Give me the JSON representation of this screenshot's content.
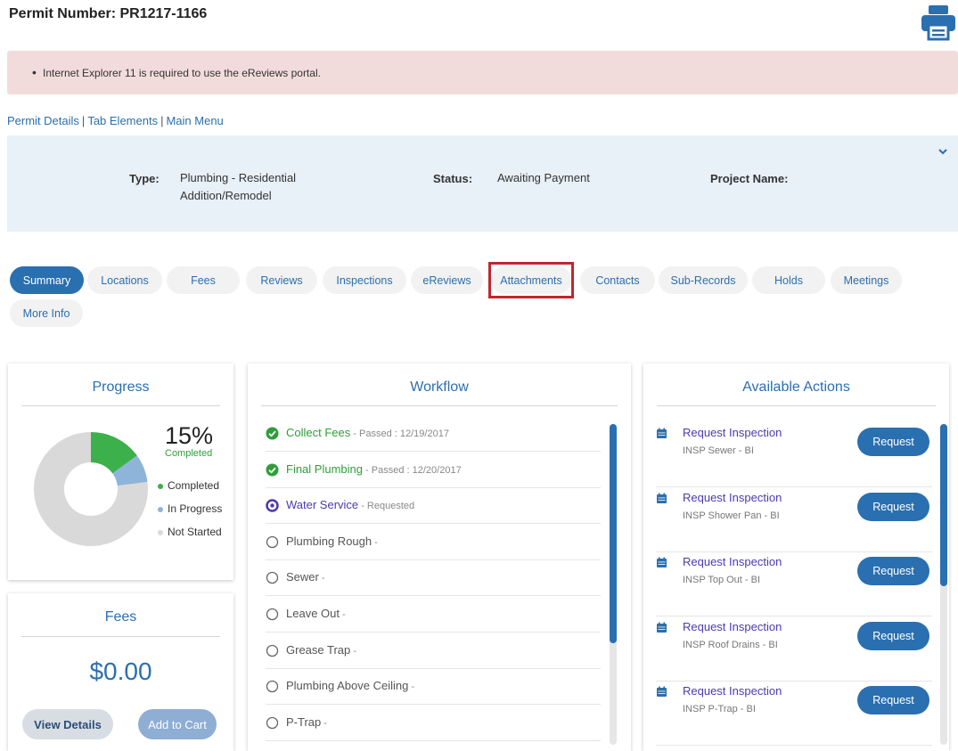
{
  "header": {
    "permit_title": "Permit Number: PR1217-1166",
    "print_icon": "print-icon"
  },
  "alert": {
    "message": "Internet Explorer 11 is required to use the eReviews portal."
  },
  "breadcrumb": {
    "items": [
      "Permit Details",
      "Tab Elements",
      "Main Menu"
    ],
    "separator": "|"
  },
  "info": {
    "type_label": "Type:",
    "type_value_line1": "Plumbing - Residential",
    "type_value_line2": "Addition/Remodel",
    "status_label": "Status:",
    "status_value": "Awaiting Payment",
    "project_label": "Project Name:",
    "project_value": ""
  },
  "tabs": [
    {
      "label": "Summary",
      "active": true
    },
    {
      "label": "Locations"
    },
    {
      "label": "Fees"
    },
    {
      "label": "Reviews"
    },
    {
      "label": "Inspections"
    },
    {
      "label": "eReviews"
    },
    {
      "label": "Attachments",
      "highlighted": true
    },
    {
      "label": "Contacts"
    },
    {
      "label": "Sub-Records"
    },
    {
      "label": "Holds"
    },
    {
      "label": "Meetings"
    },
    {
      "label": "More Info"
    }
  ],
  "progress": {
    "title": "Progress",
    "percent_text": "15%",
    "completed_text": "Completed",
    "legend": [
      {
        "label": "Completed",
        "color": "#3cb04a"
      },
      {
        "label": "In Progress",
        "color": "#8fb4d9"
      },
      {
        "label": "Not Started",
        "color": "#d9d9d9"
      }
    ],
    "completed_fraction": 0.15,
    "in_progress_fraction": 0.08
  },
  "fees": {
    "title": "Fees",
    "amount": "$0.00",
    "view_details_label": "View Details",
    "add_to_cart_label": "Add to Cart"
  },
  "workflow": {
    "title": "Workflow",
    "items": [
      {
        "name": "Collect Fees",
        "status": " - Passed : 12/19/2017",
        "state": "passed"
      },
      {
        "name": "Final Plumbing",
        "status": " - Passed : 12/20/2017",
        "state": "passed"
      },
      {
        "name": "Water Service",
        "status": " - Requested",
        "state": "requested"
      },
      {
        "name": "Plumbing Rough",
        "status": " -",
        "state": "not-started"
      },
      {
        "name": "Sewer",
        "status": " -",
        "state": "not-started"
      },
      {
        "name": "Leave Out",
        "status": " -",
        "state": "not-started"
      },
      {
        "name": "Grease Trap",
        "status": " -",
        "state": "not-started"
      },
      {
        "name": "Plumbing Above Ceiling",
        "status": " -",
        "state": "not-started"
      },
      {
        "name": "P-Trap",
        "status": " -",
        "state": "not-started"
      }
    ]
  },
  "actions": {
    "title": "Available Actions",
    "button_label": "Request",
    "items": [
      {
        "title": "Request Inspection",
        "sub": "INSP Sewer - BI"
      },
      {
        "title": "Request Inspection",
        "sub": "INSP Shower Pan - BI"
      },
      {
        "title": "Request Inspection",
        "sub": "INSP Top Out - BI"
      },
      {
        "title": "Request Inspection",
        "sub": "INSP Roof Drains - BI"
      },
      {
        "title": "Request Inspection",
        "sub": "INSP P-Trap - BI"
      }
    ]
  },
  "colors": {
    "accent": "#2a6fb0",
    "passed": "#2e9e3b",
    "requested": "#4b3ab0",
    "alert_bg": "#f2dcdb",
    "highlight": "#c0272d"
  }
}
